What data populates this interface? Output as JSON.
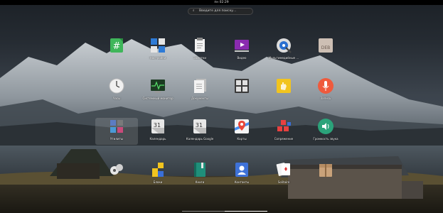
{
  "topbar": {
    "clock": "пн 02:29"
  },
  "search": {
    "placeholder": "Введите для поиску..."
  },
  "apps": [
    {
      "label": "",
      "icon": "hash-icon"
    },
    {
      "label": "Настройки",
      "icon": "tiles-icon"
    },
    {
      "label": "Заметки",
      "icon": "notes-icon"
    },
    {
      "label": "Видео",
      "icon": "video-icon"
    },
    {
      "label": "Мультимедийные ...",
      "icon": "disk-search-icon"
    },
    {
      "label": "",
      "icon": "deb-package-icon"
    },
    {
      "label": "Часы",
      "icon": "clock-icon"
    },
    {
      "label": "Системный монитор",
      "icon": "system-monitor-icon"
    },
    {
      "label": "Документы",
      "icon": "documents-icon"
    },
    {
      "label": "",
      "icon": "calculator-icon"
    },
    {
      "label": "",
      "icon": "hand-icon"
    },
    {
      "label": "Запись",
      "icon": "microphone-icon"
    },
    {
      "label": "Утилиты",
      "icon": "utilities-folder-icon"
    },
    {
      "label": "Календарь",
      "icon": "calendar-icon"
    },
    {
      "label": "Календарь Google",
      "icon": "calendar-google-icon"
    },
    {
      "label": "Карты",
      "icon": "maps-icon"
    },
    {
      "label": "Сопряжение",
      "icon": "blocks-icon"
    },
    {
      "label": "Громкость звука",
      "icon": "volume-icon"
    },
    {
      "label": "",
      "icon": "game-icon"
    },
    {
      "label": "Блоки",
      "icon": "blocks-game-icon"
    },
    {
      "label": "Книги",
      "icon": "book-icon"
    },
    {
      "label": "Контакты",
      "icon": "contacts-icon"
    },
    {
      "label": "Solitaire",
      "icon": "cards-icon"
    },
    {
      "label": "",
      "icon": "archive-icon"
    }
  ],
  "pager": {
    "page1": "",
    "page2": ""
  }
}
